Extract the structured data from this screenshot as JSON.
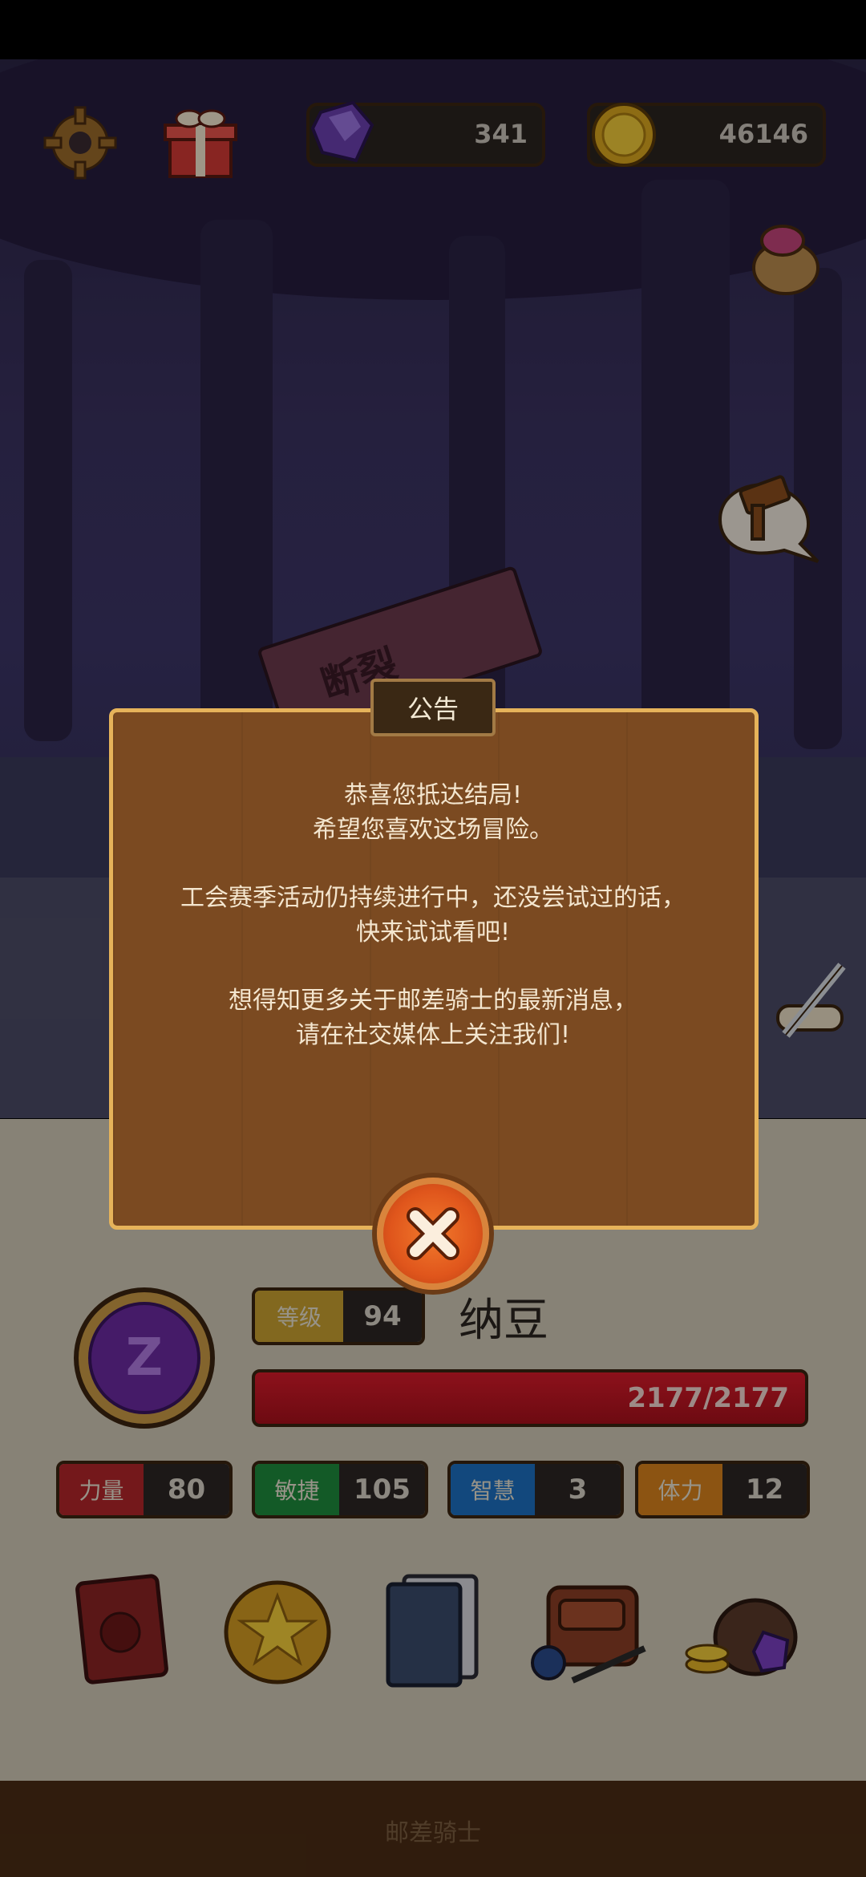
{
  "currency": {
    "gems": "341",
    "coins": "46146"
  },
  "scene_sign_text": "断裂",
  "dialog": {
    "title": "公告",
    "paragraph1_line1": "恭喜您抵达结局!",
    "paragraph1_line2": "希望您喜欢这场冒险。",
    "paragraph2_line1": "工会赛季活动仍持续进行中，还没尝试过的话，",
    "paragraph2_line2": "快来试试看吧!",
    "paragraph3_line1": "想得知更多关于邮差骑士的最新消息，",
    "paragraph3_line2": "请在社交媒体上关注我们!"
  },
  "player": {
    "level_label": "等级",
    "level": "94",
    "name": "纳豆",
    "hp": "2177/2177",
    "hp_fraction": 1.0,
    "emblem_letter": "Z"
  },
  "stats": [
    {
      "label": "力量",
      "value": "80",
      "color": "#b3252a"
    },
    {
      "label": "敏捷",
      "value": "105",
      "color": "#1e8a3c"
    },
    {
      "label": "智慧",
      "value": "3",
      "color": "#1d6fc0"
    },
    {
      "label": "体力",
      "value": "12",
      "color": "#d8821c"
    }
  ],
  "footer_title": "邮差骑士",
  "icons": [
    "gear-icon",
    "gift-icon",
    "gem-icon",
    "coin-icon",
    "loot-bag-icon",
    "hammer-speech-icon",
    "sword-scroll-icon",
    "close-icon",
    "book-icon",
    "star-coin-icon",
    "cards-icon",
    "backpack-icon",
    "treasure-bag-icon"
  ]
}
